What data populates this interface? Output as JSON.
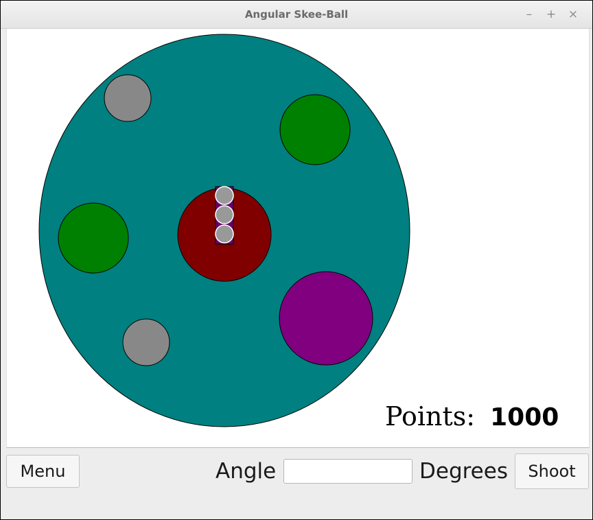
{
  "window": {
    "title": "Angular Skee-Ball",
    "controls": {
      "minimize": "–",
      "maximize": "+",
      "close": "×"
    }
  },
  "score": {
    "label": "Points:",
    "value": "1000"
  },
  "controls": {
    "menu_label": "Menu",
    "angle_label": "Angle",
    "angle_value": "",
    "degrees_label": "Degrees",
    "shoot_label": "Shoot"
  },
  "board": {
    "colors": {
      "board": "#008080",
      "center_hole": "#800000",
      "green_hole": "#008000",
      "purple_hole": "#800080",
      "gray_hole": "#888888",
      "ball": "#999999",
      "launcher": "#6b006b"
    },
    "hole_colors_present": [
      "green",
      "green",
      "purple",
      "gray",
      "gray",
      "maroon"
    ],
    "balls_remaining": 3
  }
}
